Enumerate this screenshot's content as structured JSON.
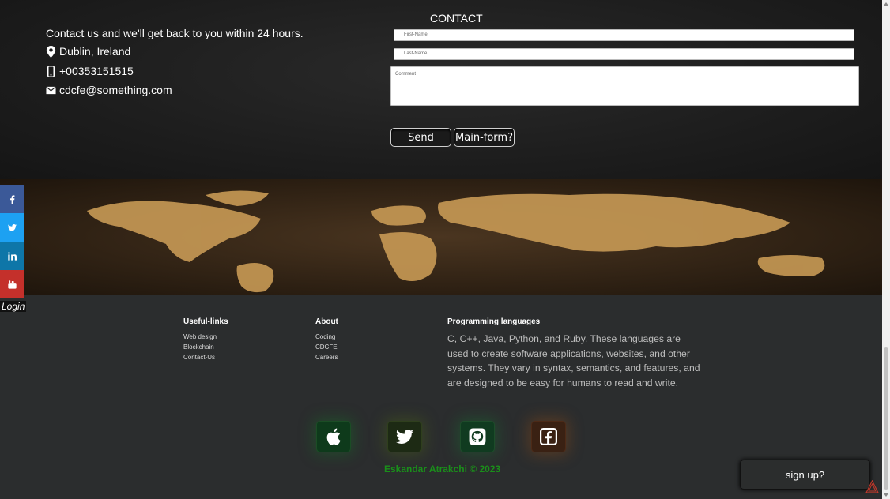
{
  "contact": {
    "intro": "Contact us and we'll get back to you within 24 hours.",
    "location": "Dublin, Ireland",
    "phone": "+00353151515",
    "email": "cdcfe@something.com",
    "title": "CONTACT",
    "first_name_placeholder": "First-Name",
    "last_name_placeholder": "Last-Name",
    "comment_placeholder": "Comment",
    "send_label": "Send",
    "main_form_label": "Main-form?"
  },
  "social": {
    "login_label": "Login",
    "icons": [
      "facebook-icon",
      "twitter-icon",
      "linkedin-icon",
      "youtube-icon"
    ]
  },
  "footer": {
    "useful_links": {
      "title": "Useful-links",
      "items": [
        "Web design",
        "Blockchain",
        "Contact-Us"
      ]
    },
    "about": {
      "title": "About",
      "items": [
        "Coding",
        "CDCFE",
        "Careers"
      ]
    },
    "programming": {
      "title": "Programming languages",
      "text": "C, C++, Java, Python, and Ruby. These languages are used to create software applications, websites, and other systems. They vary in syntax, semantics, and features, and are designed to be easy for humans to read and write."
    },
    "icon_tiles": [
      "apple-icon",
      "twitter-icon",
      "github-icon",
      "facebook-icon"
    ],
    "copyright": "Eskandar Atrakchi © 2023"
  },
  "signup_label": "sign up?",
  "colors": {
    "copyright_green": "#1a8f1a",
    "facebook": "#3b5998",
    "twitter": "#1da1f2",
    "linkedin": "#0e76a8",
    "youtube": "#c4302b"
  }
}
